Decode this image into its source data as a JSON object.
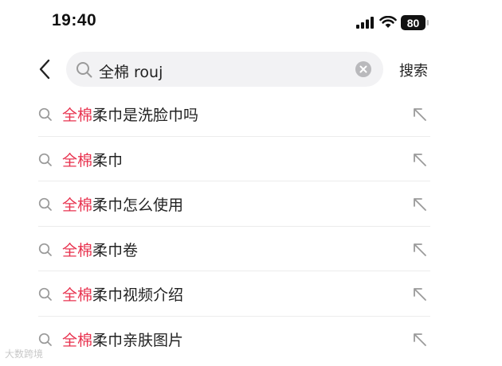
{
  "status_bar": {
    "time": "19:40",
    "battery": "80",
    "icons": [
      "signal-icon",
      "wifi-icon",
      "battery-icon"
    ]
  },
  "search": {
    "query": "全棉 rouj",
    "submit_label": "搜索",
    "icons": [
      "back-chevron-icon",
      "search-icon",
      "clear-icon"
    ]
  },
  "suggestions": [
    {
      "highlight": "全棉",
      "rest": "柔巾是洗脸巾吗"
    },
    {
      "highlight": "全棉",
      "rest": "柔巾"
    },
    {
      "highlight": "全棉",
      "rest": "柔巾怎么使用"
    },
    {
      "highlight": "全棉",
      "rest": "柔巾卷"
    },
    {
      "highlight": "全棉",
      "rest": "柔巾视频介绍"
    },
    {
      "highlight": "全棉",
      "rest": "柔巾亲肤图片"
    }
  ],
  "watermark": "大数跨境",
  "colors": {
    "highlight": "#e8334f",
    "text": "#222222",
    "search_box_bg": "#f2f2f4",
    "icon_gray": "#9a9a9a"
  }
}
